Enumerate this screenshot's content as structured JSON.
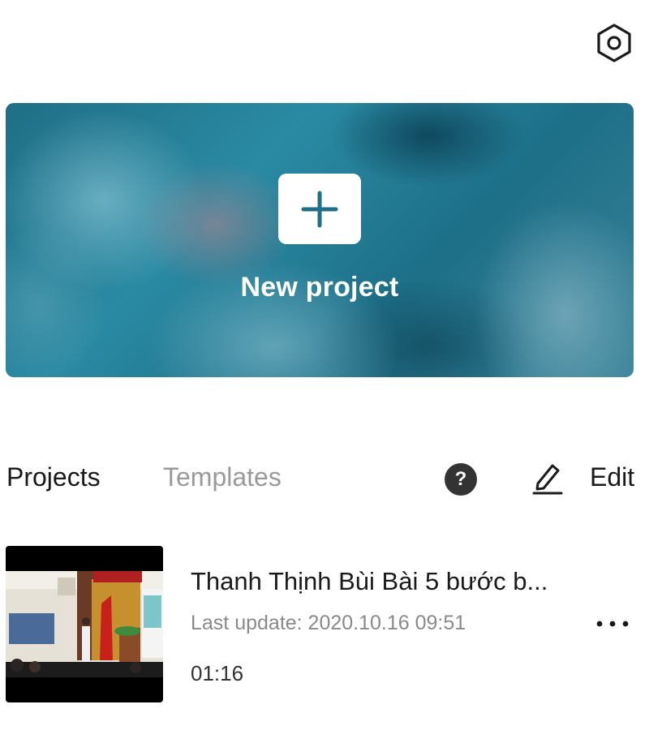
{
  "header": {
    "settings_icon": "settings-hexagon-icon"
  },
  "hero": {
    "label": "New project",
    "plus_icon": "plus-icon",
    "accent": "#1f6f86"
  },
  "tabs": [
    {
      "label": "Projects",
      "active": true
    },
    {
      "label": "Templates",
      "active": false
    }
  ],
  "toolbar": {
    "help_label": "?",
    "edit_label": "Edit",
    "edit_icon": "pencil-icon"
  },
  "projects": [
    {
      "title": "Thanh Thịnh Bùi Bài 5 bước b...",
      "last_update": "Last update: 2020.10.16 09:51",
      "duration": "01:16",
      "more_icon": "more-horizontal-icon"
    }
  ]
}
